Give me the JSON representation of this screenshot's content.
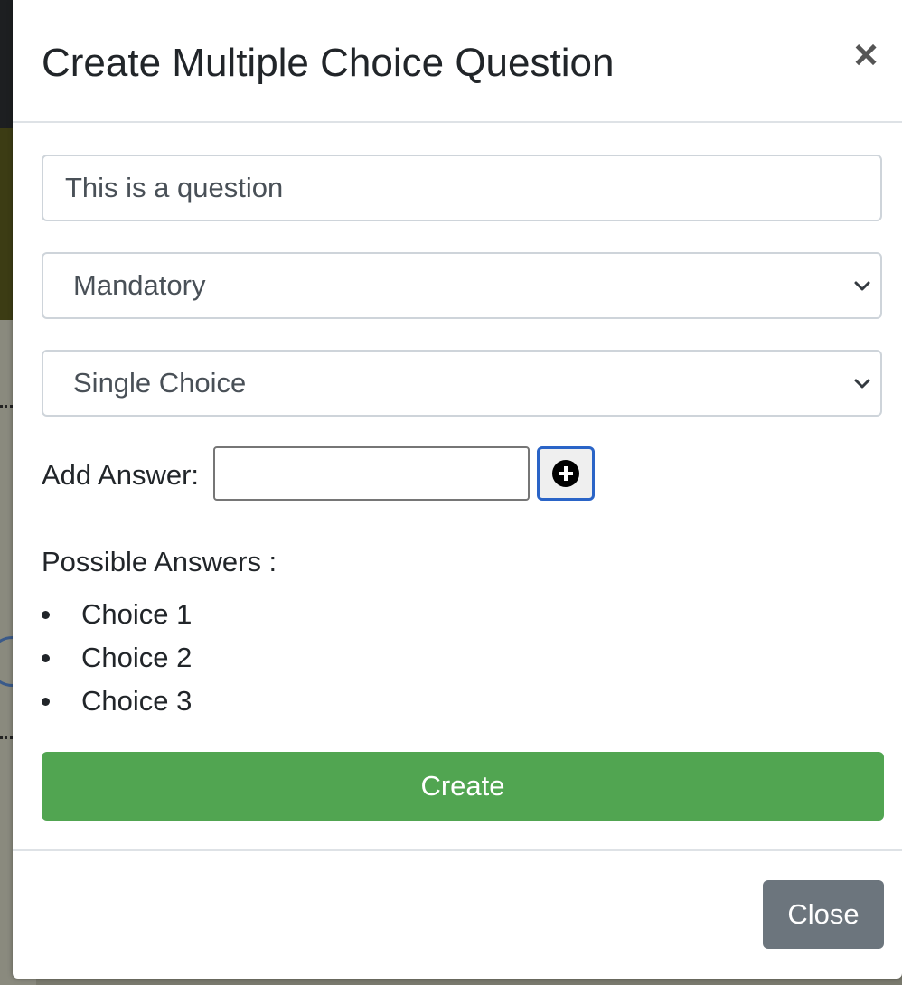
{
  "modal": {
    "title": "Create Multiple Choice Question",
    "close_symbol": "×"
  },
  "form": {
    "question_value": "This is a question",
    "mandatory_select": {
      "selected": "Mandatory"
    },
    "choice_type_select": {
      "selected": "Single Choice"
    },
    "add_answer_label": "Add Answer:",
    "add_answer_value": "",
    "add_icon": "plus-circle-icon"
  },
  "answers": {
    "title": "Possible Answers :",
    "items": [
      "Choice 1",
      "Choice 2",
      "Choice 3"
    ]
  },
  "buttons": {
    "create_label": "Create",
    "close_label": "Close"
  },
  "colors": {
    "create": "#51a551",
    "close": "#6c757d",
    "focus": "#2a64c7"
  }
}
